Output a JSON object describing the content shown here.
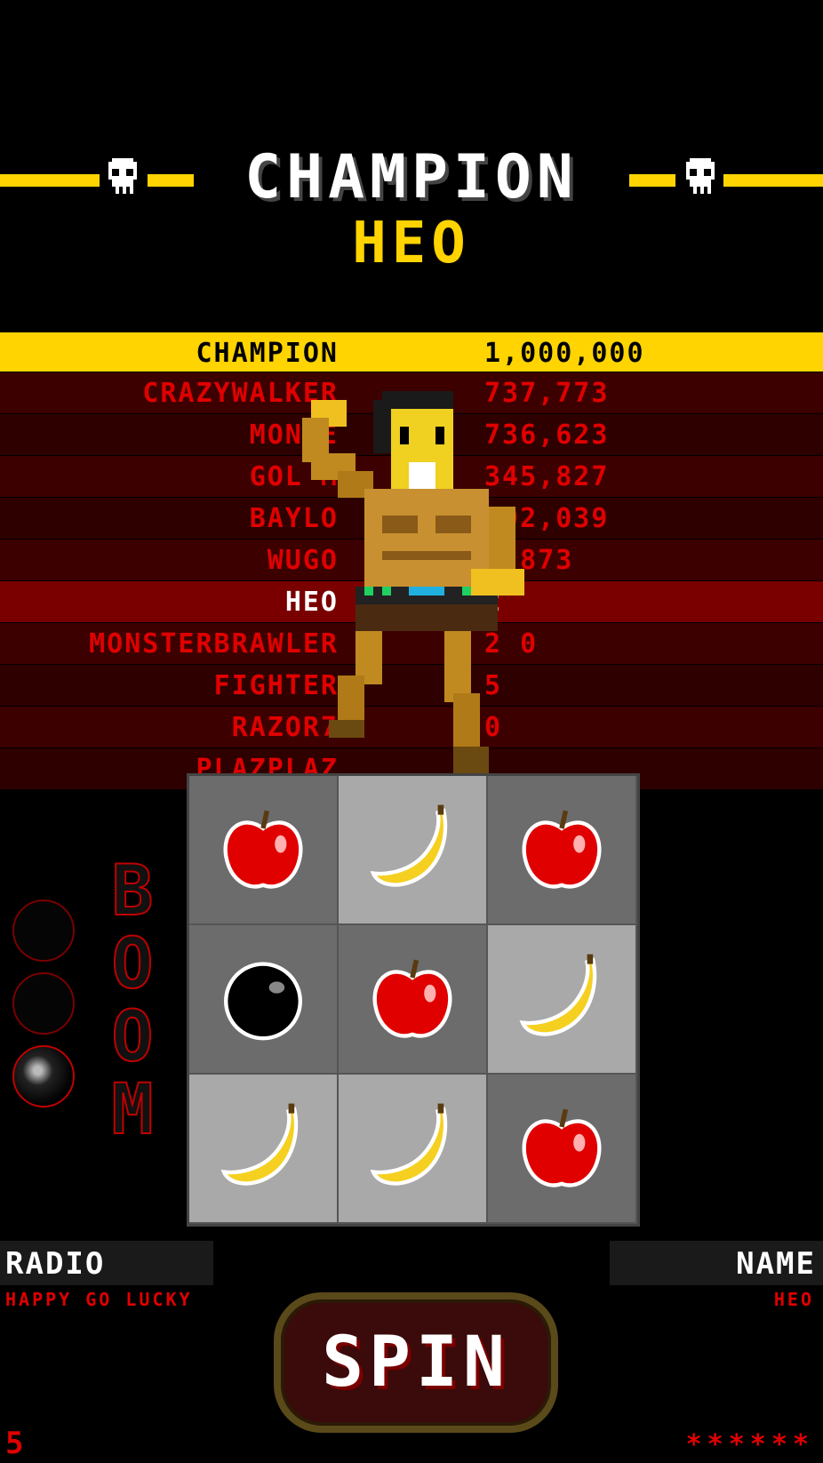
{
  "header": {
    "title": "CHAMPION",
    "champion_name": "HEO"
  },
  "leaderboard": [
    {
      "name": "CHAMPION",
      "score": "1,000,000",
      "style": "top"
    },
    {
      "name": "CRAZYWALKER",
      "score": "737,773",
      "style": ""
    },
    {
      "name": "MONKE",
      "score": "736,623",
      "style": ""
    },
    {
      "name": "GOL  M",
      "score": "345,827",
      "style": ""
    },
    {
      "name": "BAYLO",
      "score": "492,039",
      "style": ""
    },
    {
      "name": "WUGO",
      "score": "2 873",
      "style": ""
    },
    {
      "name": "HEO",
      "score": "2",
      "style": "me"
    },
    {
      "name": "MONSTERBRAWLER",
      "score": "2 0",
      "style": ""
    },
    {
      "name": "FIGHTER",
      "score": "5",
      "style": ""
    },
    {
      "name": "RAZOR7",
      "score": "0",
      "style": ""
    },
    {
      "name": "PLAZPLAZ",
      "score": "",
      "style": ""
    }
  ],
  "reels": [
    [
      "apple",
      "banana",
      "apple"
    ],
    [
      "bomb",
      "apple",
      "banana"
    ],
    [
      "banana",
      "banana",
      "apple"
    ]
  ],
  "reel_shades": [
    [
      "dark",
      "light",
      "dark"
    ],
    [
      "dark",
      "dark",
      "light"
    ],
    [
      "light",
      "light",
      "dark"
    ]
  ],
  "boom": {
    "letters": [
      "B",
      "O",
      "O",
      "M"
    ]
  },
  "bomb_slots": {
    "filled": 1,
    "total": 3
  },
  "radio": {
    "label": "RADIO",
    "value": "HAPPY GO LUCKY"
  },
  "player": {
    "label": "NAME",
    "value": "HEO"
  },
  "spin_label": "SPIN",
  "credits": "5",
  "password_mask": "******",
  "colors": {
    "accent_yellow": "#ffd400",
    "red": "#e00000",
    "row_dark": "#3d0000"
  }
}
